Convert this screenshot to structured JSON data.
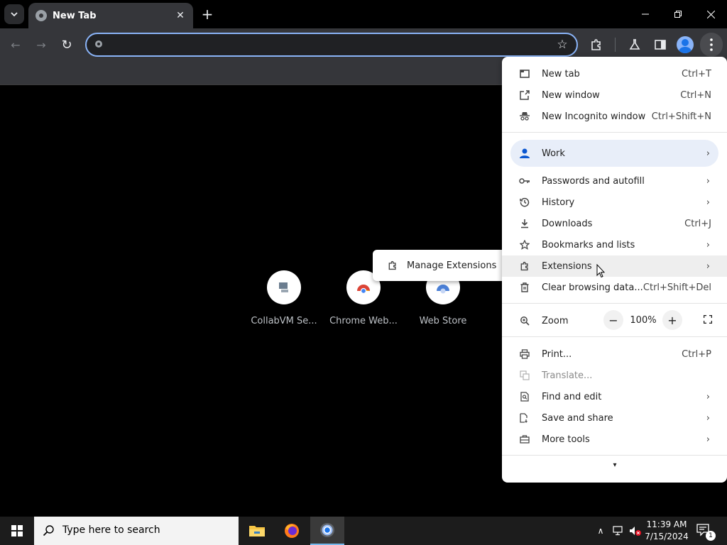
{
  "browser": {
    "tab": {
      "title": "New Tab",
      "close_glyph": "✕"
    },
    "new_tab_glyph": "+",
    "window_controls": {
      "minimize": "—",
      "maximize": "❐",
      "close": "✕"
    },
    "toolbar": {
      "back_glyph": "←",
      "forward_glyph": "→",
      "reload_glyph": "↻",
      "address_value": "",
      "star_glyph": "☆"
    }
  },
  "shortcuts": [
    {
      "label": "CollabVM Se..."
    },
    {
      "label": "Chrome Web..."
    },
    {
      "label": "Web Store"
    }
  ],
  "menu": {
    "new_tab": {
      "label": "New tab",
      "shortcut": "Ctrl+T"
    },
    "new_window": {
      "label": "New window",
      "shortcut": "Ctrl+N"
    },
    "new_incognito": {
      "label": "New Incognito window",
      "shortcut": "Ctrl+Shift+N"
    },
    "profile": {
      "label": "Work"
    },
    "passwords": {
      "label": "Passwords and autofill"
    },
    "history": {
      "label": "History"
    },
    "downloads": {
      "label": "Downloads",
      "shortcut": "Ctrl+J"
    },
    "bookmarks": {
      "label": "Bookmarks and lists"
    },
    "extensions": {
      "label": "Extensions"
    },
    "clear_data": {
      "label": "Clear browsing data...",
      "shortcut": "Ctrl+Shift+Del"
    },
    "zoom": {
      "label": "Zoom",
      "minus": "−",
      "value": "100%",
      "plus": "+"
    },
    "print": {
      "label": "Print...",
      "shortcut": "Ctrl+P"
    },
    "translate": {
      "label": "Translate..."
    },
    "find_edit": {
      "label": "Find and edit"
    },
    "save_share": {
      "label": "Save and share"
    },
    "more_tools": {
      "label": "More tools"
    },
    "arrow_glyph": "›",
    "more_glyph": "▾"
  },
  "submenu": {
    "manage_extensions": "Manage Extensions"
  },
  "taskbar": {
    "search_placeholder": "Type here to search",
    "clock_time": "11:39 AM",
    "clock_date": "7/15/2024",
    "notification_count": "1",
    "tray_chevron": "∧"
  },
  "colors": {
    "accent": "#8ab4f8",
    "menu_bg": "#ffffff",
    "toolbar_bg": "#35363a",
    "profile_highlight": "#e8eef9"
  }
}
